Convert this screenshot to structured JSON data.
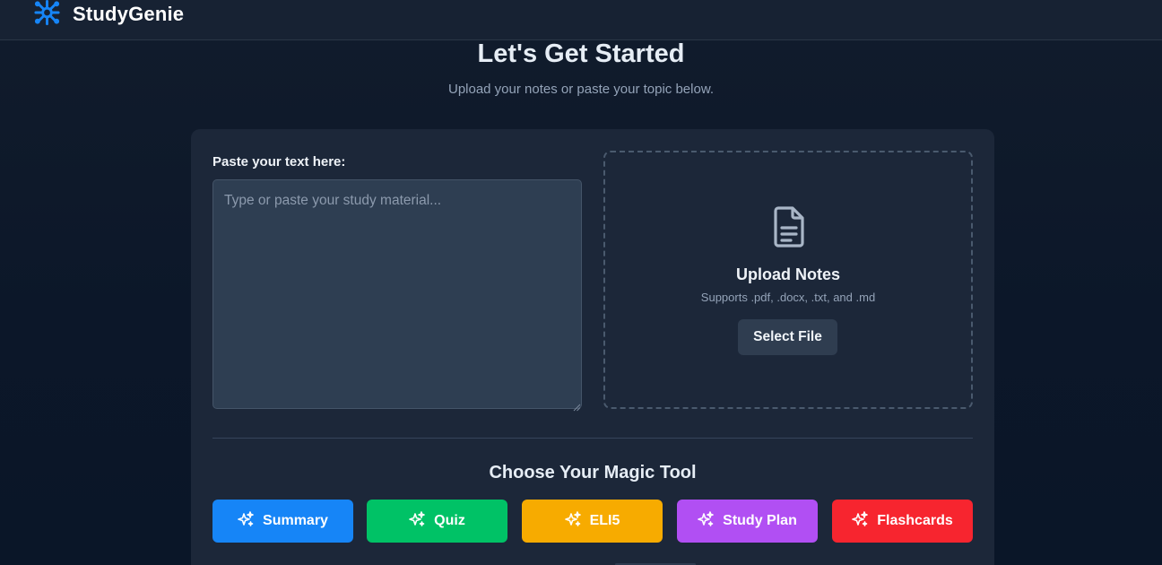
{
  "app": {
    "name": "StudyGenie",
    "brand_color": "#1685f7",
    "logo_icon": "brain-network-icon"
  },
  "hero": {
    "title": "Let's Get Started",
    "subtitle": "Upload your notes or paste your topic below."
  },
  "paste": {
    "label": "Paste your text here:",
    "placeholder": "Type or paste your study material...",
    "value": ""
  },
  "upload": {
    "icon": "file-text-icon",
    "title": "Upload Notes",
    "supports": "Supports .pdf, .docx, .txt, and .md",
    "button_label": "Select File"
  },
  "tools": {
    "title": "Choose Your Magic Tool",
    "icon": "sparkles-icon",
    "buttons": [
      {
        "label": "Summary",
        "color": "#1685f7"
      },
      {
        "label": "Quiz",
        "color": "#00c266"
      },
      {
        "label": "ELI5",
        "color": "#f7ab00"
      },
      {
        "label": "Study Plan",
        "color": "#b14ff3"
      },
      {
        "label": "Flashcards",
        "color": "#f7252f"
      }
    ]
  }
}
